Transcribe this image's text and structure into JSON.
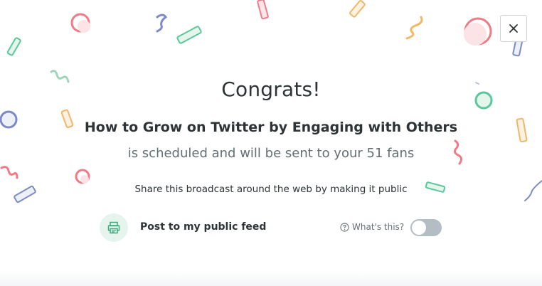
{
  "dialog": {
    "title": "Congrats!",
    "broadcast_title": "How to Grow on Twitter by Engaging with Others",
    "subtitle": "is scheduled and will be sent to your 51 fans",
    "share_text": "Share this broadcast around the web by making it public",
    "close_icon": "close-icon"
  },
  "feed": {
    "icon": "printer-icon",
    "label": "Post to my public feed",
    "help_icon": "question-circle-icon",
    "help_label": "What's this?",
    "toggle_on": false
  },
  "colors": {
    "toggle_off": "#b2bec3",
    "icon_bg": "#e6f4ee",
    "icon_green": "#3daa7a",
    "confetti_green": "#5cc79a",
    "confetti_pink": "#f07a86",
    "confetti_orange": "#f2b766",
    "confetti_blue": "#7c8bc4"
  }
}
